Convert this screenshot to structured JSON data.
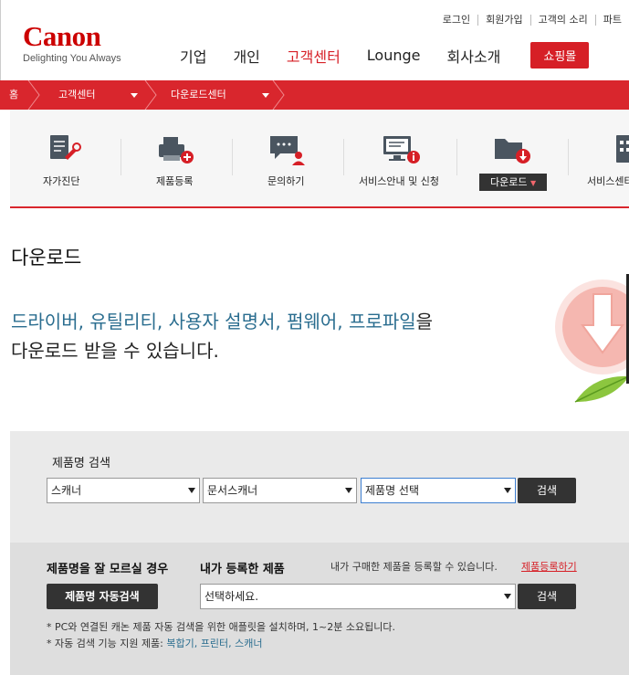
{
  "header": {
    "logo": "Canon",
    "tagline": "Delighting You Always",
    "util_links": [
      "로그인",
      "회원가입",
      "고객의 소리",
      "파트"
    ],
    "nav": [
      "기업",
      "개인",
      "고객센터",
      "Lounge",
      "회사소개"
    ],
    "active_nav": "고객센터",
    "shop_label": "쇼핑몰",
    "accent_color": "#d61f26"
  },
  "breadcrumb": {
    "home": "홈",
    "level1": "고객센터",
    "level2": "다운로드센터"
  },
  "service_menu": [
    {
      "label": "자가진단",
      "icon": "self-diagnosis-icon"
    },
    {
      "label": "제품등록",
      "icon": "product-register-icon"
    },
    {
      "label": "문의하기",
      "icon": "inquiry-icon"
    },
    {
      "label": "서비스안내 및 신청",
      "icon": "service-info-icon"
    },
    {
      "label": "다운로드",
      "icon": "download-folder-icon",
      "active": true
    },
    {
      "label": "서비스센터",
      "icon": "service-center-icon"
    }
  ],
  "page": {
    "title": "다운로드",
    "intro_blue": "드라이버, 유틸리티, 사용자 설명서, 펌웨어, 프로파일",
    "intro_suffix": "을",
    "intro_line2": "다운로드 받을 수 있습니다."
  },
  "search": {
    "label": "제품명 검색",
    "select1": "스캐너",
    "select2": "문서스캐너",
    "select3": "제품명 선택",
    "button": "검색"
  },
  "auto": {
    "unknown_heading": "제품명을 잘 모르실 경우",
    "auto_button": "제품명 자동검색",
    "registered_heading": "내가 등록한 제품",
    "register_note": "내가 구매한 제품을 등록할 수 있습니다.",
    "register_link": "제품등록하기",
    "registered_select": "선택하세요.",
    "button": "검색",
    "note1": "* PC와 연결된 캐논 제품 자동 검색을 위한 애플릿을 설치하며, 1~2분 소요됩니다.",
    "note2_prefix": "* 자동 검색 기능 지원 제품: ",
    "note2_products": "복합기, 프린터, 스캐너"
  }
}
